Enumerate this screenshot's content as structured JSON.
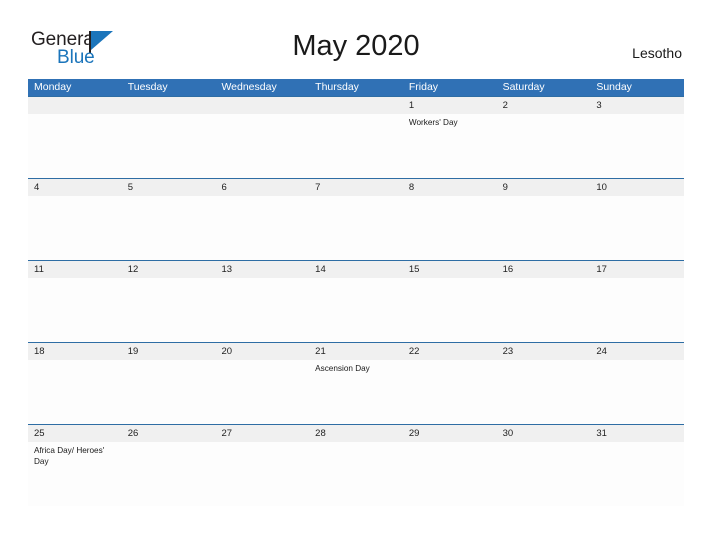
{
  "brand": {
    "name_part1": "General",
    "name_part2": "Blue",
    "flag_icon": "flag-triangle-icon",
    "accent_color": "#1b75bb"
  },
  "header": {
    "title": "May 2020",
    "region": "Lesotho"
  },
  "colors": {
    "header_bar": "#3071b5",
    "date_band": "#f0f0f0",
    "row_divider": "#2e6da4",
    "text": "#1a1a1a"
  },
  "calendar": {
    "weekdays": [
      "Monday",
      "Tuesday",
      "Wednesday",
      "Thursday",
      "Friday",
      "Saturday",
      "Sunday"
    ],
    "weeks": [
      {
        "days": [
          {
            "date": "",
            "event": ""
          },
          {
            "date": "",
            "event": ""
          },
          {
            "date": "",
            "event": ""
          },
          {
            "date": "",
            "event": ""
          },
          {
            "date": "1",
            "event": "Workers' Day"
          },
          {
            "date": "2",
            "event": ""
          },
          {
            "date": "3",
            "event": ""
          }
        ]
      },
      {
        "days": [
          {
            "date": "4",
            "event": ""
          },
          {
            "date": "5",
            "event": ""
          },
          {
            "date": "6",
            "event": ""
          },
          {
            "date": "7",
            "event": ""
          },
          {
            "date": "8",
            "event": ""
          },
          {
            "date": "9",
            "event": ""
          },
          {
            "date": "10",
            "event": ""
          }
        ]
      },
      {
        "days": [
          {
            "date": "11",
            "event": ""
          },
          {
            "date": "12",
            "event": ""
          },
          {
            "date": "13",
            "event": ""
          },
          {
            "date": "14",
            "event": ""
          },
          {
            "date": "15",
            "event": ""
          },
          {
            "date": "16",
            "event": ""
          },
          {
            "date": "17",
            "event": ""
          }
        ]
      },
      {
        "days": [
          {
            "date": "18",
            "event": ""
          },
          {
            "date": "19",
            "event": ""
          },
          {
            "date": "20",
            "event": ""
          },
          {
            "date": "21",
            "event": "Ascension Day"
          },
          {
            "date": "22",
            "event": ""
          },
          {
            "date": "23",
            "event": ""
          },
          {
            "date": "24",
            "event": ""
          }
        ]
      },
      {
        "days": [
          {
            "date": "25",
            "event": "Africa Day/ Heroes' Day"
          },
          {
            "date": "26",
            "event": ""
          },
          {
            "date": "27",
            "event": ""
          },
          {
            "date": "28",
            "event": ""
          },
          {
            "date": "29",
            "event": ""
          },
          {
            "date": "30",
            "event": ""
          },
          {
            "date": "31",
            "event": ""
          }
        ]
      }
    ]
  }
}
